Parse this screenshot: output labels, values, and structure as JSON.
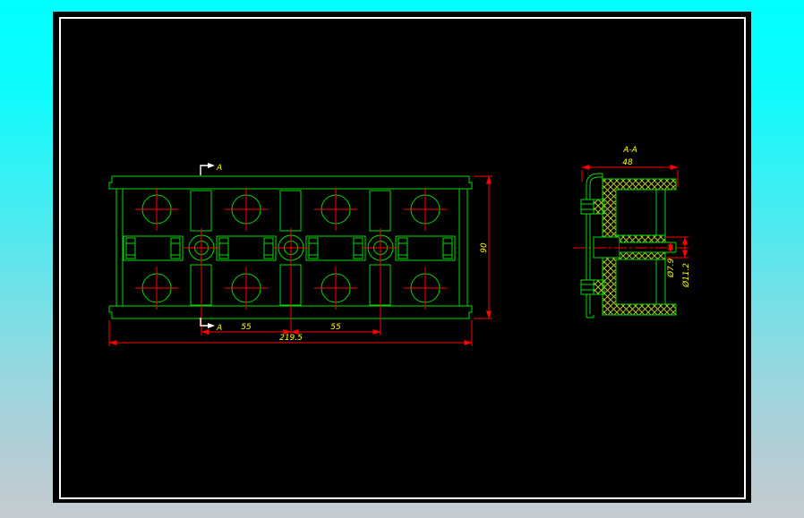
{
  "desktop": {
    "bg_top": "#00ffff",
    "bg_bottom": "#c3cbd1"
  },
  "canvas": {
    "background": "#000000",
    "border_color": "#ffffff"
  },
  "drawing": {
    "colors": {
      "outline": "#00dd00",
      "dimension_line": "#ff0000",
      "dimension_text": "#ffff00",
      "hatch": "#b5c22c",
      "section_marker": "#ffffff"
    },
    "front_view": {
      "section_label_top": "A",
      "section_label_bottom": "A",
      "dim_pitch_1": "55",
      "dim_pitch_2": "55",
      "dim_overall_width": "219.5",
      "dim_overall_height": "90",
      "features": {
        "large_holes": 8,
        "small_holes": 3,
        "horizontal_slots": 4,
        "vertical_slots": 6
      }
    },
    "section_view": {
      "title": "A-A",
      "dim_width": "48",
      "dim_hole_inner": "Ø7.9",
      "dim_hole_outer": "Ø11.2"
    }
  }
}
